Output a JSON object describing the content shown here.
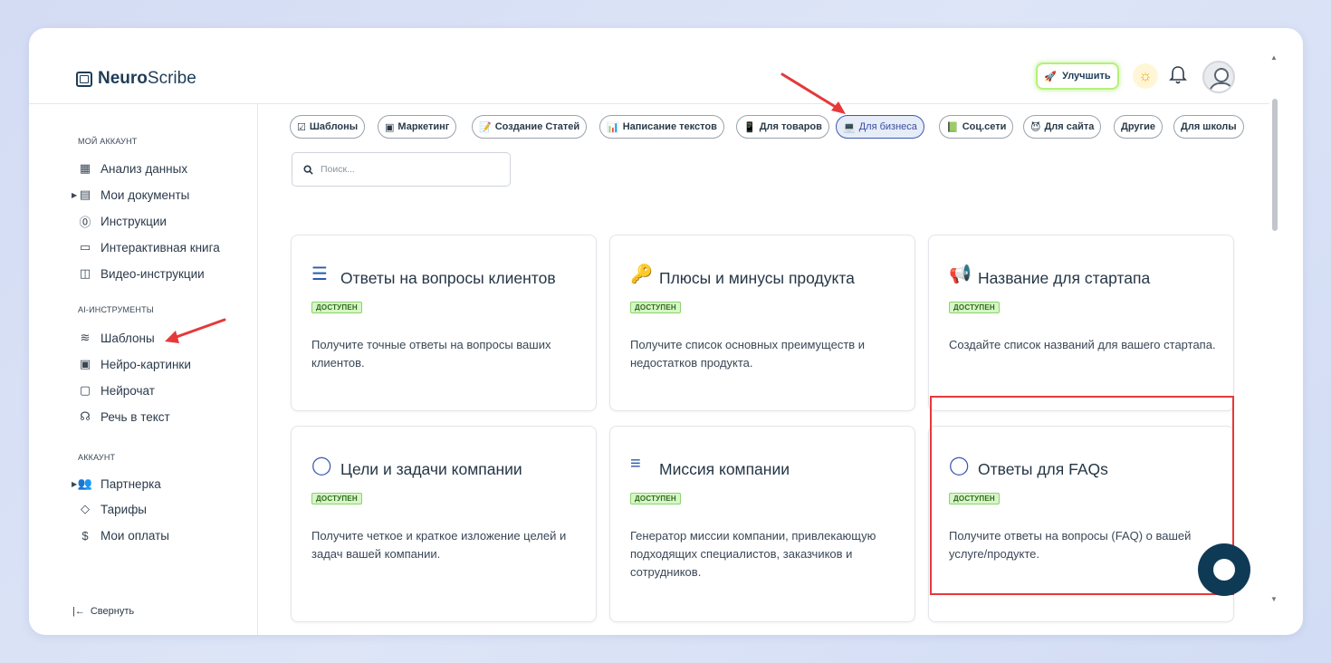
{
  "app": {
    "logo_bold": "Neuro",
    "logo_rest": "Scribe"
  },
  "header": {
    "upgrade_label": "Улучшить"
  },
  "sidebar": {
    "section_account": "МОЙ АККАУНТ",
    "section_ai": "AI-ИНСТРУМЕНТЫ",
    "section_acc": "АККАУНТ",
    "items": [
      {
        "label": "Анализ данных",
        "icon": "grid-icon"
      },
      {
        "label": "Мои документы",
        "icon": "document-icon"
      },
      {
        "label": "Инструкции",
        "icon": "help-circle-icon"
      },
      {
        "label": "Интерактивная книга",
        "icon": "book-icon"
      },
      {
        "label": "Видео-инструкции",
        "icon": "video-icon"
      },
      {
        "label": "Шаблоны",
        "icon": "layers-icon"
      },
      {
        "label": "Нейро-картинки",
        "icon": "image-icon"
      },
      {
        "label": "Нейрочат",
        "icon": "chat-icon"
      },
      {
        "label": "Речь в текст",
        "icon": "headphones-icon"
      },
      {
        "label": "Партнерка",
        "icon": "users-icon"
      },
      {
        "label": "Тарифы",
        "icon": "tag-icon"
      },
      {
        "label": "Мои оплаты",
        "icon": "dollar-icon"
      }
    ],
    "collapse_label": "Свернуть"
  },
  "categories": [
    {
      "label": "Шаблоны",
      "emoji": "☑"
    },
    {
      "label": "Маркетинг",
      "emoji": "▣"
    },
    {
      "label": "Создание Статей",
      "emoji": "📝"
    },
    {
      "label": "Написание текстов",
      "emoji": "📊"
    },
    {
      "label": "Для товаров",
      "emoji": "📱"
    },
    {
      "label": "Для бизнеса",
      "emoji": "💻"
    },
    {
      "label": "Соц.сети",
      "emoji": "📗"
    },
    {
      "label": "Для сайта",
      "emoji": "😈"
    },
    {
      "label": "Другие",
      "emoji": ""
    },
    {
      "label": "Для школы",
      "emoji": ""
    }
  ],
  "active_category": "Для бизнеса",
  "search": {
    "placeholder": "Поиск..."
  },
  "cards": [
    {
      "title": "Ответы на вопросы клиентов",
      "badge": "ДОСТУПЕН",
      "desc": "Получите точные ответы на вопросы ваших клиентов.",
      "emoji": "☰"
    },
    {
      "title": "Плюсы и минусы продукта",
      "badge": "ДОСТУПЕН",
      "desc": "Получите список основных преимуществ и недостатков продукта.",
      "emoji": "🔑"
    },
    {
      "title": "Название для стартапа",
      "badge": "ДОСТУПЕН",
      "desc": "Создайте список названий для вашего стартапа.",
      "emoji": "📢"
    },
    {
      "title": "Цели и задачи компании",
      "badge": "ДОСТУПЕН",
      "desc": "Получите четкое и краткое изложение целей и задач вашей компании.",
      "emoji": "◯"
    },
    {
      "title": "Миссия компании",
      "badge": "ДОСТУПЕН",
      "desc": "Генератор миссии компании, привлекающую подходящих специалистов, заказчиков и сотрудников.",
      "emoji": "≡"
    },
    {
      "title": "Ответы для FAQs",
      "badge": "ДОСТУПЕН",
      "desc": "Получите ответы на вопросы (FAQ) о вашей услуге/продукте.",
      "emoji": "◯"
    }
  ],
  "colors": {
    "accent": "#3b5bb0",
    "highlight": "#e5393a",
    "badge_bg": "#d7f5c7",
    "brand_dark": "#0f3a56"
  }
}
